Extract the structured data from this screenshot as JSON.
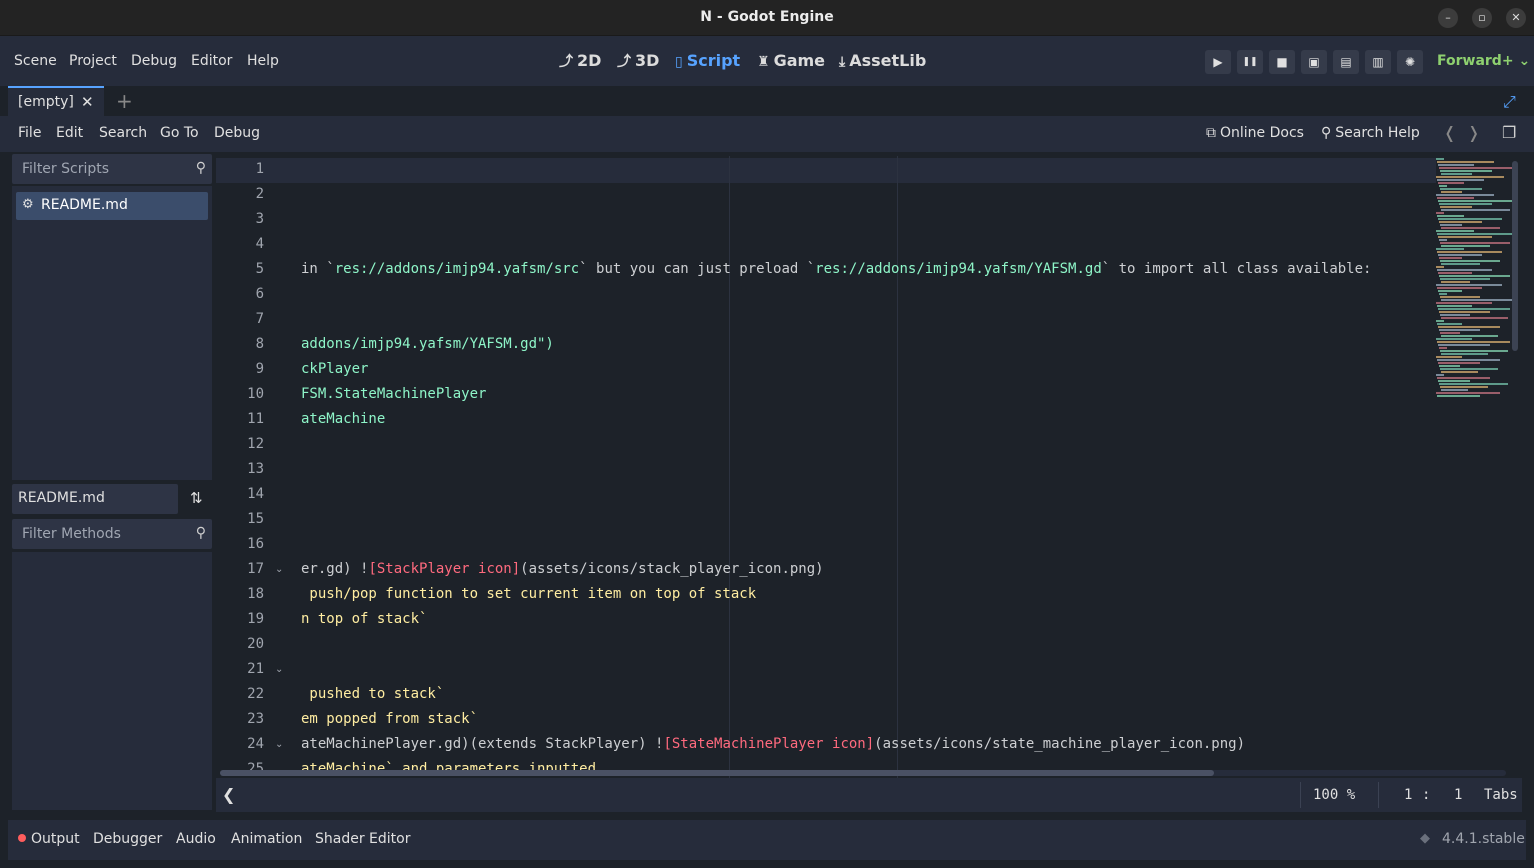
{
  "window": {
    "title": "N - Godot Engine",
    "controls": {
      "minimize": "–",
      "maximize": "▫",
      "close": "✕"
    }
  },
  "menu": {
    "items": [
      "Scene",
      "Project",
      "Debug",
      "Editor",
      "Help"
    ],
    "workspaces": [
      {
        "label": "2D",
        "icon": "2d-icon",
        "glyph": "⤴"
      },
      {
        "label": "3D",
        "icon": "3d-icon",
        "glyph": "⤴"
      },
      {
        "label": "Script",
        "icon": "script-icon",
        "glyph": "▯",
        "active": true
      },
      {
        "label": "Game",
        "icon": "game-icon",
        "glyph": "♜"
      },
      {
        "label": "AssetLib",
        "icon": "assetlib-icon",
        "glyph": "⤓"
      }
    ],
    "play_buttons": [
      {
        "name": "play-button",
        "glyph": "▶"
      },
      {
        "name": "pause-button",
        "glyph": "❚❚"
      },
      {
        "name": "stop-button",
        "glyph": "■"
      },
      {
        "name": "remote-debug-button",
        "glyph": "▣"
      },
      {
        "name": "play-scene-button",
        "glyph": "▤"
      },
      {
        "name": "play-custom-scene-button",
        "glyph": "▥"
      },
      {
        "name": "movie-maker-button",
        "glyph": "✺"
      }
    ],
    "renderer": "Forward+",
    "renderer_arrow": "⌄"
  },
  "tabs": {
    "items": [
      {
        "label": "[empty]",
        "close": "✕"
      }
    ],
    "add": "+",
    "fullscreen": "⤢"
  },
  "script_menu": {
    "items": [
      "File",
      "Edit",
      "Search",
      "Go To",
      "Debug"
    ],
    "online_docs": "Online Docs",
    "search_help": "Search Help",
    "nav_back": "❬",
    "nav_forward": "❭",
    "docks_glyph": "❐"
  },
  "scripts_panel": {
    "filter_placeholder": "Filter Scripts",
    "items": [
      {
        "label": "README.md"
      }
    ],
    "current_file": "README.md",
    "sort_glyph": "⇅",
    "methods_placeholder": "Filter Methods",
    "search_glyph": "⚲"
  },
  "editor": {
    "lines": [
      {
        "n": "1",
        "segs": []
      },
      {
        "n": "2",
        "segs": []
      },
      {
        "n": "3",
        "segs": []
      },
      {
        "n": "4",
        "segs": []
      },
      {
        "n": "5",
        "segs": [
          {
            "t": "in `",
            "c": ""
          },
          {
            "t": "res://addons/imjp94.yafsm/src",
            "c": "green"
          },
          {
            "t": "` but you can just preload `",
            "c": ""
          },
          {
            "t": "res://addons/imjp94.yafsm/YAFSM.gd",
            "c": "green"
          },
          {
            "t": "` to import all class available:",
            "c": ""
          }
        ]
      },
      {
        "n": "6",
        "segs": []
      },
      {
        "n": "7",
        "segs": []
      },
      {
        "n": "8",
        "segs": [
          {
            "t": "addons/imjp94.yafsm/YAFSM.gd\")",
            "c": "green"
          }
        ]
      },
      {
        "n": "9",
        "segs": [
          {
            "t": "ckPlayer",
            "c": "green"
          }
        ]
      },
      {
        "n": "10",
        "segs": [
          {
            "t": "FSM.StateMachinePlayer",
            "c": "green"
          }
        ]
      },
      {
        "n": "11",
        "segs": [
          {
            "t": "ateMachine",
            "c": "green"
          }
        ]
      },
      {
        "n": "12",
        "segs": []
      },
      {
        "n": "13",
        "segs": []
      },
      {
        "n": "14",
        "segs": []
      },
      {
        "n": "15",
        "segs": []
      },
      {
        "n": "16",
        "segs": []
      },
      {
        "n": "17",
        "fold": true,
        "segs": [
          {
            "t": "er.gd) !",
            "c": ""
          },
          {
            "t": "[StackPlayer icon]",
            "c": "red"
          },
          {
            "t": "(assets/icons/stack_player_icon.png)",
            "c": ""
          }
        ]
      },
      {
        "n": "18",
        "segs": [
          {
            "t": " push/pop function to set current item on top of stack",
            "c": "yellow"
          }
        ]
      },
      {
        "n": "19",
        "segs": [
          {
            "t": "n top of stack`",
            "c": "yellow"
          }
        ]
      },
      {
        "n": "20",
        "segs": []
      },
      {
        "n": "21",
        "fold": true,
        "segs": []
      },
      {
        "n": "22",
        "segs": [
          {
            "t": " pushed to stack`",
            "c": "yellow"
          }
        ]
      },
      {
        "n": "23",
        "segs": [
          {
            "t": "em popped from stack`",
            "c": "yellow"
          }
        ]
      },
      {
        "n": "24",
        "fold": true,
        "segs": [
          {
            "t": "ateMachinePlayer.gd)(extends StackPlayer) !",
            "c": ""
          },
          {
            "t": "[StateMachinePlayer icon]",
            "c": "red"
          },
          {
            "t": "(assets/icons/state_machine_player_icon.png)",
            "c": ""
          }
        ]
      },
      {
        "n": "25",
        "segs": [
          {
            "t": "ateMachine` and parameters inputted",
            "c": "yellow"
          }
        ]
      }
    ]
  },
  "status": {
    "toggle_glyph": "❮",
    "zoom": "100 %",
    "line": "1",
    "col_sep": ":",
    "column": "1",
    "indent": "Tabs"
  },
  "bottom_panel": {
    "items": [
      "Output",
      "Debugger",
      "Audio",
      "Animation",
      "Shader Editor"
    ],
    "version": "4.4.1.stable"
  }
}
